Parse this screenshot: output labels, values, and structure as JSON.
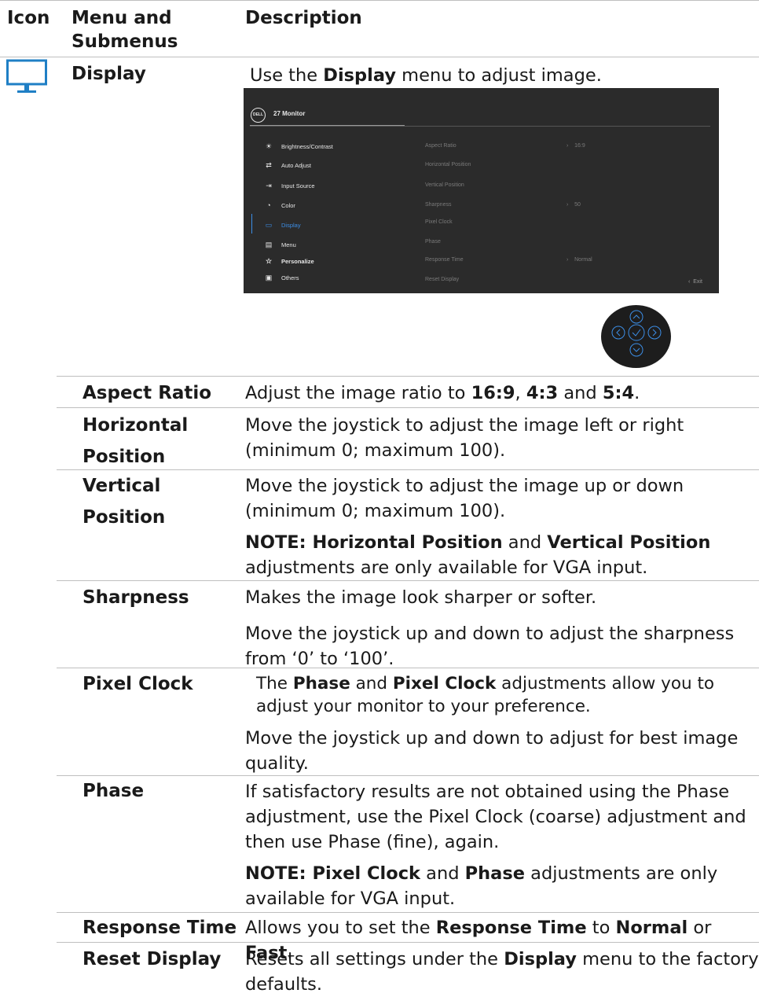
{
  "header": {
    "icon": "Icon",
    "menu": "Menu and Submenus",
    "description": "Description"
  },
  "display_row": {
    "icon": "monitor-icon",
    "label": "Display",
    "desc_pre": "Use the ",
    "desc_bold": "Display",
    "desc_post": " menu to adjust image."
  },
  "osd": {
    "title": "27 Monitor",
    "logo": "DELL",
    "menu": [
      "Brightness/Contrast",
      "Auto Adjust",
      "Input Source",
      "Color",
      "Display",
      "Menu",
      "Personalize",
      "Others"
    ],
    "options": [
      "Aspect Ratio",
      "Horizontal Position",
      "Vertical Position",
      "Sharpness",
      "Pixel Clock",
      "Phase",
      "Response Time",
      "Reset Display"
    ],
    "values": [
      "16:9",
      "50",
      "Normal"
    ],
    "exit": "Exit",
    "accent": "#3c8ee6",
    "bg": "#2b2b2b"
  },
  "rows": {
    "aspect": {
      "label": "Aspect Ratio",
      "t1": "Adjust the image ratio to ",
      "b1": "16:9",
      "t2": ", ",
      "b2": "4:3",
      "t3": " and ",
      "b3": "5:4",
      "t4": "."
    },
    "horizontal": {
      "label1": "Horizontal",
      "label2": "Position",
      "line1": "Move the joystick to adjust the image left or right",
      "line2": "(minimum 0; maximum 100)."
    },
    "vertical": {
      "label1": "Vertical",
      "label2": "Position",
      "line1": "Move the joystick to adjust the image  up or down",
      "line2": "(minimum 0; maximum 100).",
      "note_b1": "NOTE: Horizontal Position",
      "note_t1": " and ",
      "note_b2": "Vertical Position",
      "note_line2": "adjustments are only available for VGA input."
    },
    "sharpness": {
      "label": "Sharpness",
      "line1": "Makes the image look sharper or softer.",
      "line2": "Move the joystick up and down to adjust the sharpness",
      "line3": "from ‘0’ to ‘100’."
    },
    "pixel_clock": {
      "label": "Pixel Clock",
      "t1": "The ",
      "b1": "Phase",
      "t2": " and ",
      "b2": "Pixel Clock",
      "t3": " adjustments allow you to",
      "line2": "adjust your monitor to your preference.",
      "line3": "Move the joystick up and down to adjust for best image",
      "line4": "quality."
    },
    "phase": {
      "label": "Phase",
      "line1": "If satisfactory results are not obtained using the Phase",
      "line2": "adjustment, use the Pixel Clock (coarse) adjustment and",
      "line3": "then use Phase (fine), again.",
      "note_b1": "NOTE: Pixel Clock",
      "note_t1": " and ",
      "note_b2": "Phase",
      "note_t2": " adjustments are only",
      "note_line2": "available for VGA input."
    },
    "response": {
      "label": "Response Time",
      "t1": "Allows you to set the ",
      "b1": "Response Time",
      "t2": " to ",
      "b2": "Normal",
      "t3": " or ",
      "b3": "Fast",
      "t4": "."
    },
    "reset": {
      "label": "Reset Display",
      "t1": "Resets all settings under the ",
      "b1": "Display",
      "t2": " menu to the factory",
      "line2": "defaults."
    }
  }
}
